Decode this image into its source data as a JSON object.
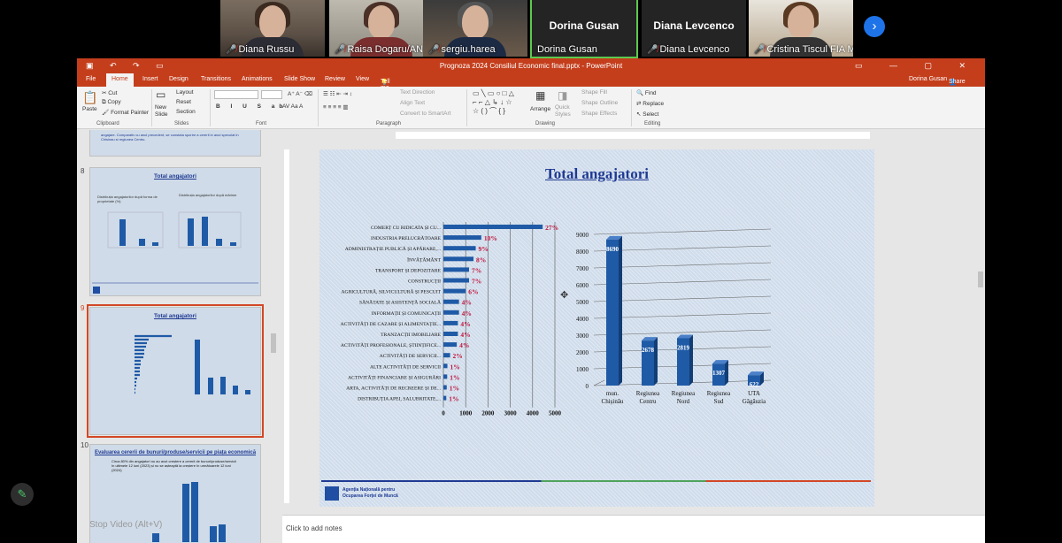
{
  "participants": [
    {
      "name": "Diana Russu",
      "muted": true
    },
    {
      "name": "Raisa Dogaru/ANOF...",
      "muted": true
    },
    {
      "name": "sergiu.harea",
      "muted": true
    },
    {
      "name": "Dorina Gusan",
      "display": "Dorina Gusan",
      "muted": false
    },
    {
      "name": "Diana Levcenco",
      "display": "Diana Levcenco",
      "muted": true
    },
    {
      "name": "Cristina Tiscul FIA MO...",
      "muted": true
    }
  ],
  "window": {
    "title": "Prognoza 2024 Consiliul Economic final.pptx - PowerPoint",
    "user": "Dorina Gusan",
    "share": "Share"
  },
  "ribbon_tabs": [
    "File",
    "Home",
    "Insert",
    "Design",
    "Transitions",
    "Animations",
    "Slide Show",
    "Review",
    "View"
  ],
  "tell_me": "Tell me what you want to do...",
  "ribbon": {
    "paste": "Paste",
    "cut": "Cut",
    "copy": "Copy",
    "format_painter": "Format Painter",
    "new_slide": "New Slide",
    "layout": "Layout",
    "reset": "Reset",
    "section": "Section",
    "text_direction": "Text Direction",
    "align_text": "Align Text",
    "convert_smartart": "Convert to SmartArt",
    "arrange": "Arrange",
    "quick_styles": "Quick Styles",
    "shape_fill": "Shape Fill",
    "shape_outline": "Shape Outline",
    "shape_effects": "Shape Effects",
    "find": "Find",
    "replace": "Replace",
    "select": "Select",
    "groups": {
      "clipboard": "Clipboard",
      "slides": "Slides",
      "font": "Font",
      "paragraph": "Paragraph",
      "drawing": "Drawing",
      "editing": "Editing"
    }
  },
  "thumbnails": {
    "slide7_text": "angajare. Comparativ cu anul precedent, se constata sporire a cererii in anul speculat in Chisinau si regiunea Centru.",
    "slide8": {
      "num": "8",
      "title": "Total angajatori",
      "left_caption": "Distribuția angajatorilor după forma de proprietate (%)",
      "right_caption": "Distribuția angajatorilor după mărime"
    },
    "slide9": {
      "num": "9",
      "title": "Total angajatori"
    },
    "slide10": {
      "num": "10",
      "title": "Evaluarea cererii de bunuri/produse/servicii pe piața economică",
      "text": "Circa 80% din angajatori nu au avut creștere a cererii de bunuri/produse/servicii în ultimele 12 luni (2023) și nu se așteaptă la creștere în următoarele 12 luni (2024)"
    }
  },
  "notes_placeholder": "Click to add notes",
  "stop_video": "Stop Video (Alt+V)",
  "slide": {
    "title": "Total  angajatori",
    "footer_line1": "Agenția Națională pentru",
    "footer_line2": "Ocuparea Forței de Muncă"
  },
  "chart_data": [
    {
      "type": "bar",
      "orientation": "horizontal",
      "categories": [
        "COMERȚ CU RIDICATA ȘI CU...",
        "INDUSTRIA PRELUCRĂTOARE",
        "ADMINISTRAȚIE PUBLICĂ ȘI APĂRARE,...",
        "ÎNVĂȚĂMÂNT",
        "TRANSPORT ȘI DEPOZITARE",
        "CONSTRUCȚII",
        "AGRICULTURĂ, SILVICULTURĂ ȘI PESCUIT",
        "SĂNĂTATE ȘI ASISTENȚĂ SOCIALĂ",
        "INFORMAȚII ȘI COMUNICAȚII",
        "ACTIVITĂȚI DE CAZARE ȘI ALIMENTAȚIE...",
        "TRANZACȚII IMOBILIARE",
        "ACTIVITĂȚI PROFESIONALE, ȘTIINȚIFICE...",
        "ACTIVITĂȚI DE SERVICII...",
        "ALTE ACTIVITĂȚI DE SERVICII",
        "ACTIVITĂȚI FINANCIARE ȘI ASIGURĂRI",
        "ARTA, ACTIVITĂȚI DE RECREERE ȘI DE...",
        "DISTRIBUȚIA APEI, SALUBRITATE,..."
      ],
      "values": [
        4450,
        1700,
        1450,
        1350,
        1150,
        1150,
        1000,
        700,
        700,
        650,
        650,
        600,
        300,
        180,
        170,
        150,
        130
      ],
      "data_labels": [
        "27%",
        "10%",
        "9%",
        "8%",
        "7%",
        "7%",
        "6%",
        "4%",
        "4%",
        "4%",
        "4%",
        "4%",
        "2%",
        "1%",
        "1%",
        "1%",
        "1%"
      ],
      "xticks": [
        "0",
        "1000",
        "2000",
        "3000",
        "4000",
        "5000"
      ],
      "xlim": [
        0,
        5000
      ],
      "grid": true,
      "colors": {
        "bar": "#1f5aa6",
        "label": "#c0143c"
      }
    },
    {
      "type": "bar",
      "style": "3d-column",
      "categories": [
        "mun. Chișinău",
        "Regiunea Centru",
        "Regiunea Nord",
        "Regiunea Sud",
        "UTA Găgăuzia"
      ],
      "values": [
        8690,
        2678,
        2819,
        1307,
        622
      ],
      "yticks": [
        "0",
        "1000",
        "2000",
        "3000",
        "4000",
        "5000",
        "6000",
        "7000",
        "8000",
        "9000"
      ],
      "ylim": [
        0,
        9000
      ],
      "grid": true,
      "colors": {
        "bar": "#1f5aa6"
      }
    }
  ]
}
